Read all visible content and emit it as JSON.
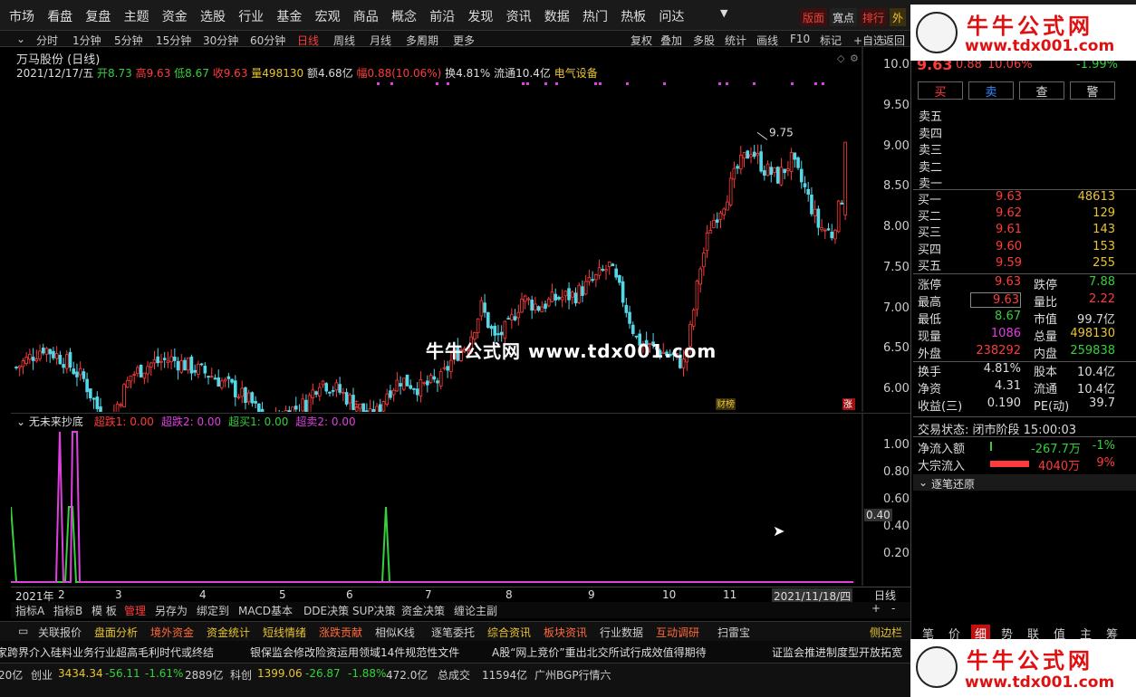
{
  "top_menu": [
    "市场",
    "看盘",
    "复盘",
    "主题",
    "资金",
    "选股",
    "行业",
    "基金",
    "宏观",
    "商品",
    "概念",
    "前沿",
    "发现",
    "资讯",
    "数据",
    "热门",
    "热板",
    "问达"
  ],
  "top_right": [
    "版面",
    "寬点",
    "排行",
    "外"
  ],
  "period_bar": [
    "分时",
    "1分钟",
    "5分钟",
    "15分钟",
    "30分钟",
    "60分钟",
    "日线",
    "周线",
    "月线",
    "多周期",
    "更多"
  ],
  "tool_bar": [
    "复权",
    "叠加",
    "多股",
    "统计",
    "画线",
    "F10",
    "标记",
    "+自选",
    "返回"
  ],
  "chart": {
    "title": "万马股份 (日线)",
    "date": "2021/12/17/五",
    "open": "开8.73",
    "high": "高9.63",
    "low": "低8.67",
    "close": "收9.63",
    "volume": "量498130",
    "amount": "额4.68亿",
    "amp": "幅0.88(10.06%)",
    "turnover": "换4.81%",
    "float": "流通10.4亿",
    "sector": "电气设备",
    "price_axis": [
      "10.00",
      "9.50",
      "9.00",
      "8.50",
      "8.00",
      "7.50",
      "7.00",
      "6.50",
      "6.00"
    ],
    "high_label": "9.75",
    "low_label": "5.94",
    "markers": [
      "$",
      "财榜",
      "涨"
    ],
    "month_labels": [
      "2021年",
      "2",
      "3",
      "4",
      "5",
      "6",
      "7",
      "8",
      "9",
      "10",
      "11"
    ],
    "last_date": "2021/11/18/四",
    "period_tag": "日线"
  },
  "indicator": {
    "name": "无未来抄底",
    "legend": [
      {
        "label": "超跌1: 0.00",
        "color": "#ff3b3b"
      },
      {
        "label": "超跌2: 0.00",
        "color": "#e040e0"
      },
      {
        "label": "超买1: 0.00",
        "color": "#35d03c"
      },
      {
        "label": "超卖2: 0.00",
        "color": "#e040e0"
      }
    ],
    "axis": [
      "1.00",
      "0.80",
      "0.60",
      "0.40",
      "0.20"
    ],
    "cursor_value": "0.40"
  },
  "index_tabs": [
    "指标A",
    "指标B",
    "模 板",
    "管理",
    "另存为",
    "绑定到",
    "MACD基本",
    "DDE决策",
    "SUP决策",
    "资金决策",
    "缠论主副"
  ],
  "bottom_tabs": [
    "关联报价",
    "盘面分析",
    "境外资金",
    "资金统计",
    "短线情绪",
    "涨跌贡献",
    "相似K线",
    "逐笔委托",
    "综合资讯",
    "板块资讯",
    "行业数据",
    "互动调研",
    "扫雷宝",
    "侧边栏"
  ],
  "ticker": [
    "家跨界介入硅料业务行业超高毛利时代或终结",
    "银保监会修改险资运用领域14件规范性文件",
    "A股“网上竞价”重出北交所试行成效值得期待",
    "证监会推进制度型开放拓宽"
  ],
  "status": {
    "items": [
      "20亿",
      "创业",
      "3434.34",
      "-56.11",
      "-1.61%",
      "2889亿",
      "科创",
      "1399.06",
      "-26.87",
      "-1.88%",
      "472.0亿",
      "总成交",
      "11594亿",
      "广州BGP行情六"
    ]
  },
  "quote": {
    "price": "9.63",
    "change": "0.88",
    "pct": "10.06%",
    "right_pct": "-1.99%",
    "buttons": [
      "买",
      "卖",
      "查",
      "警"
    ],
    "sell_levels": [
      "卖五",
      "卖四",
      "卖三",
      "卖二",
      "卖一"
    ],
    "buy_levels": [
      {
        "label": "买一",
        "price": "9.63",
        "vol": "48613"
      },
      {
        "label": "买二",
        "price": "9.62",
        "vol": "129"
      },
      {
        "label": "买三",
        "price": "9.61",
        "vol": "143"
      },
      {
        "label": "买四",
        "price": "9.60",
        "vol": "153"
      },
      {
        "label": "买五",
        "price": "9.59",
        "vol": "255"
      }
    ],
    "stats": [
      {
        "k1": "涨停",
        "v1": "9.63",
        "k2": "跌停",
        "v2": "7.88"
      },
      {
        "k1": "最高",
        "v1": "9.63",
        "k2": "量比",
        "v2": "2.22"
      },
      {
        "k1": "最低",
        "v1": "8.67",
        "k2": "市值",
        "v2": "99.7亿"
      },
      {
        "k1": "现量",
        "v1": "1086",
        "k2": "总量",
        "v2": "498130"
      },
      {
        "k1": "外盘",
        "v1": "238292",
        "k2": "内盘",
        "v2": "259838"
      }
    ],
    "stats2": [
      {
        "k1": "换手",
        "v1": "4.81%",
        "k2": "股本",
        "v2": "10.4亿"
      },
      {
        "k1": "净资",
        "v1": "4.31",
        "k2": "流通",
        "v2": "10.4亿"
      },
      {
        "k1": "收益(三)",
        "v1": "0.190",
        "k2": "PE(动)",
        "v2": "39.7"
      }
    ],
    "trade_state": "交易状态: 闭市阶段 15:00:03",
    "net_inflow_label": "净流入额",
    "net_inflow": "-267.7万",
    "net_inflow_pct": "-1%",
    "block_label": "大宗流入",
    "block": "4040万",
    "block_pct": "9%",
    "tick_restore": "逐笔还原",
    "side_tabs": [
      "笔",
      "价",
      "细",
      "势",
      "联",
      "值",
      "主",
      "筹"
    ]
  },
  "watermark": {
    "center": "牛牛公式网 www.tdx001.com",
    "brand": "牛牛公式网",
    "url": "www.tdx001.com"
  }
}
